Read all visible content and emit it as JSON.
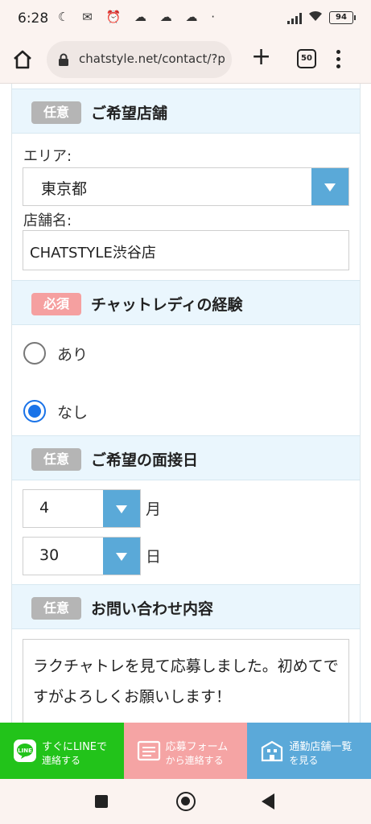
{
  "status_bar": {
    "time": "6:28",
    "left_icons": "☾ ✉ ⏰ ☁ ☁ ☁ ·",
    "battery": "94"
  },
  "browser": {
    "url": "chatstyle.net/contact/?po",
    "tab_count": "50"
  },
  "sections": {
    "store": {
      "badge": "任意",
      "title": "ご希望店舗",
      "area_label": "エリア:",
      "area_value": "東京都",
      "store_label": "店舗名:",
      "store_value": "CHATSTYLE渋谷店"
    },
    "experience": {
      "badge": "必須",
      "title": "チャットレディの経験",
      "options": [
        {
          "label": "あり",
          "selected": false
        },
        {
          "label": "なし",
          "selected": true
        }
      ]
    },
    "interview": {
      "badge": "任意",
      "title": "ご希望の面接日",
      "month_value": "4",
      "month_unit": "月",
      "day_value": "30",
      "day_unit": "日"
    },
    "inquiry": {
      "badge": "任意",
      "title": "お問い合わせ内容",
      "content": "ラクチャトレを見て応募しました。初めてですがよろしくお願いします！"
    }
  },
  "cta": {
    "line": {
      "line1": "すぐにLINEで",
      "line2": "連絡する",
      "icon": "line-icon",
      "color": "#22c31a"
    },
    "form": {
      "line1": "応募フォーム",
      "line2": "から連絡する",
      "icon": "form-icon",
      "color": "#f5a4a4"
    },
    "shop": {
      "line1": "通勤店舗一覧",
      "line2": "を見る",
      "icon": "building-icon",
      "color": "#5ba9d9"
    }
  },
  "colors": {
    "section_header_bg": "#eaf6fd",
    "badge_optional": "#b5b5b5",
    "badge_required": "#f5a0a0",
    "select_arrow": "#5aa9d8",
    "radio_selected": "#1a73e8"
  }
}
